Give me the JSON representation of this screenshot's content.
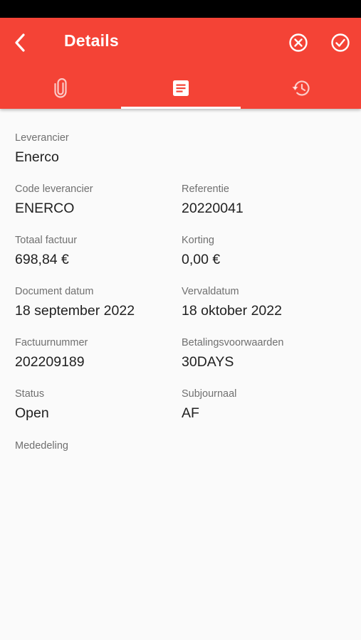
{
  "header": {
    "title": "Details",
    "background_color": "#f44336",
    "back_icon": "chevron-left-icon",
    "cancel_icon": "close-circle-icon",
    "confirm_icon": "check-circle-icon"
  },
  "tabs": [
    {
      "icon": "paperclip-icon",
      "selected": false
    },
    {
      "icon": "document-icon",
      "selected": true
    },
    {
      "icon": "history-icon",
      "selected": false
    }
  ],
  "fields": {
    "leverancier": {
      "label": "Leverancier",
      "value": "Enerco"
    },
    "code_leverancier": {
      "label": "Code leverancier",
      "value": "ENERCO"
    },
    "referentie": {
      "label": "Referentie",
      "value": "20220041"
    },
    "totaal_factuur": {
      "label": "Totaal factuur",
      "value": "698,84 €"
    },
    "korting": {
      "label": "Korting",
      "value": "0,00 €"
    },
    "document_datum": {
      "label": "Document datum",
      "value": "18 september 2022"
    },
    "vervaldatum": {
      "label": "Vervaldatum",
      "value": "18 oktober 2022"
    },
    "factuurnummer": {
      "label": "Factuurnummer",
      "value": "202209189"
    },
    "betalingsvoorwaarden": {
      "label": "Betalingsvoorwaarden",
      "value": "30DAYS"
    },
    "status": {
      "label": "Status",
      "value": "Open"
    },
    "subjournaal": {
      "label": "Subjournaal",
      "value": "AF"
    },
    "mededeling": {
      "label": "Mededeling",
      "value": ""
    }
  }
}
